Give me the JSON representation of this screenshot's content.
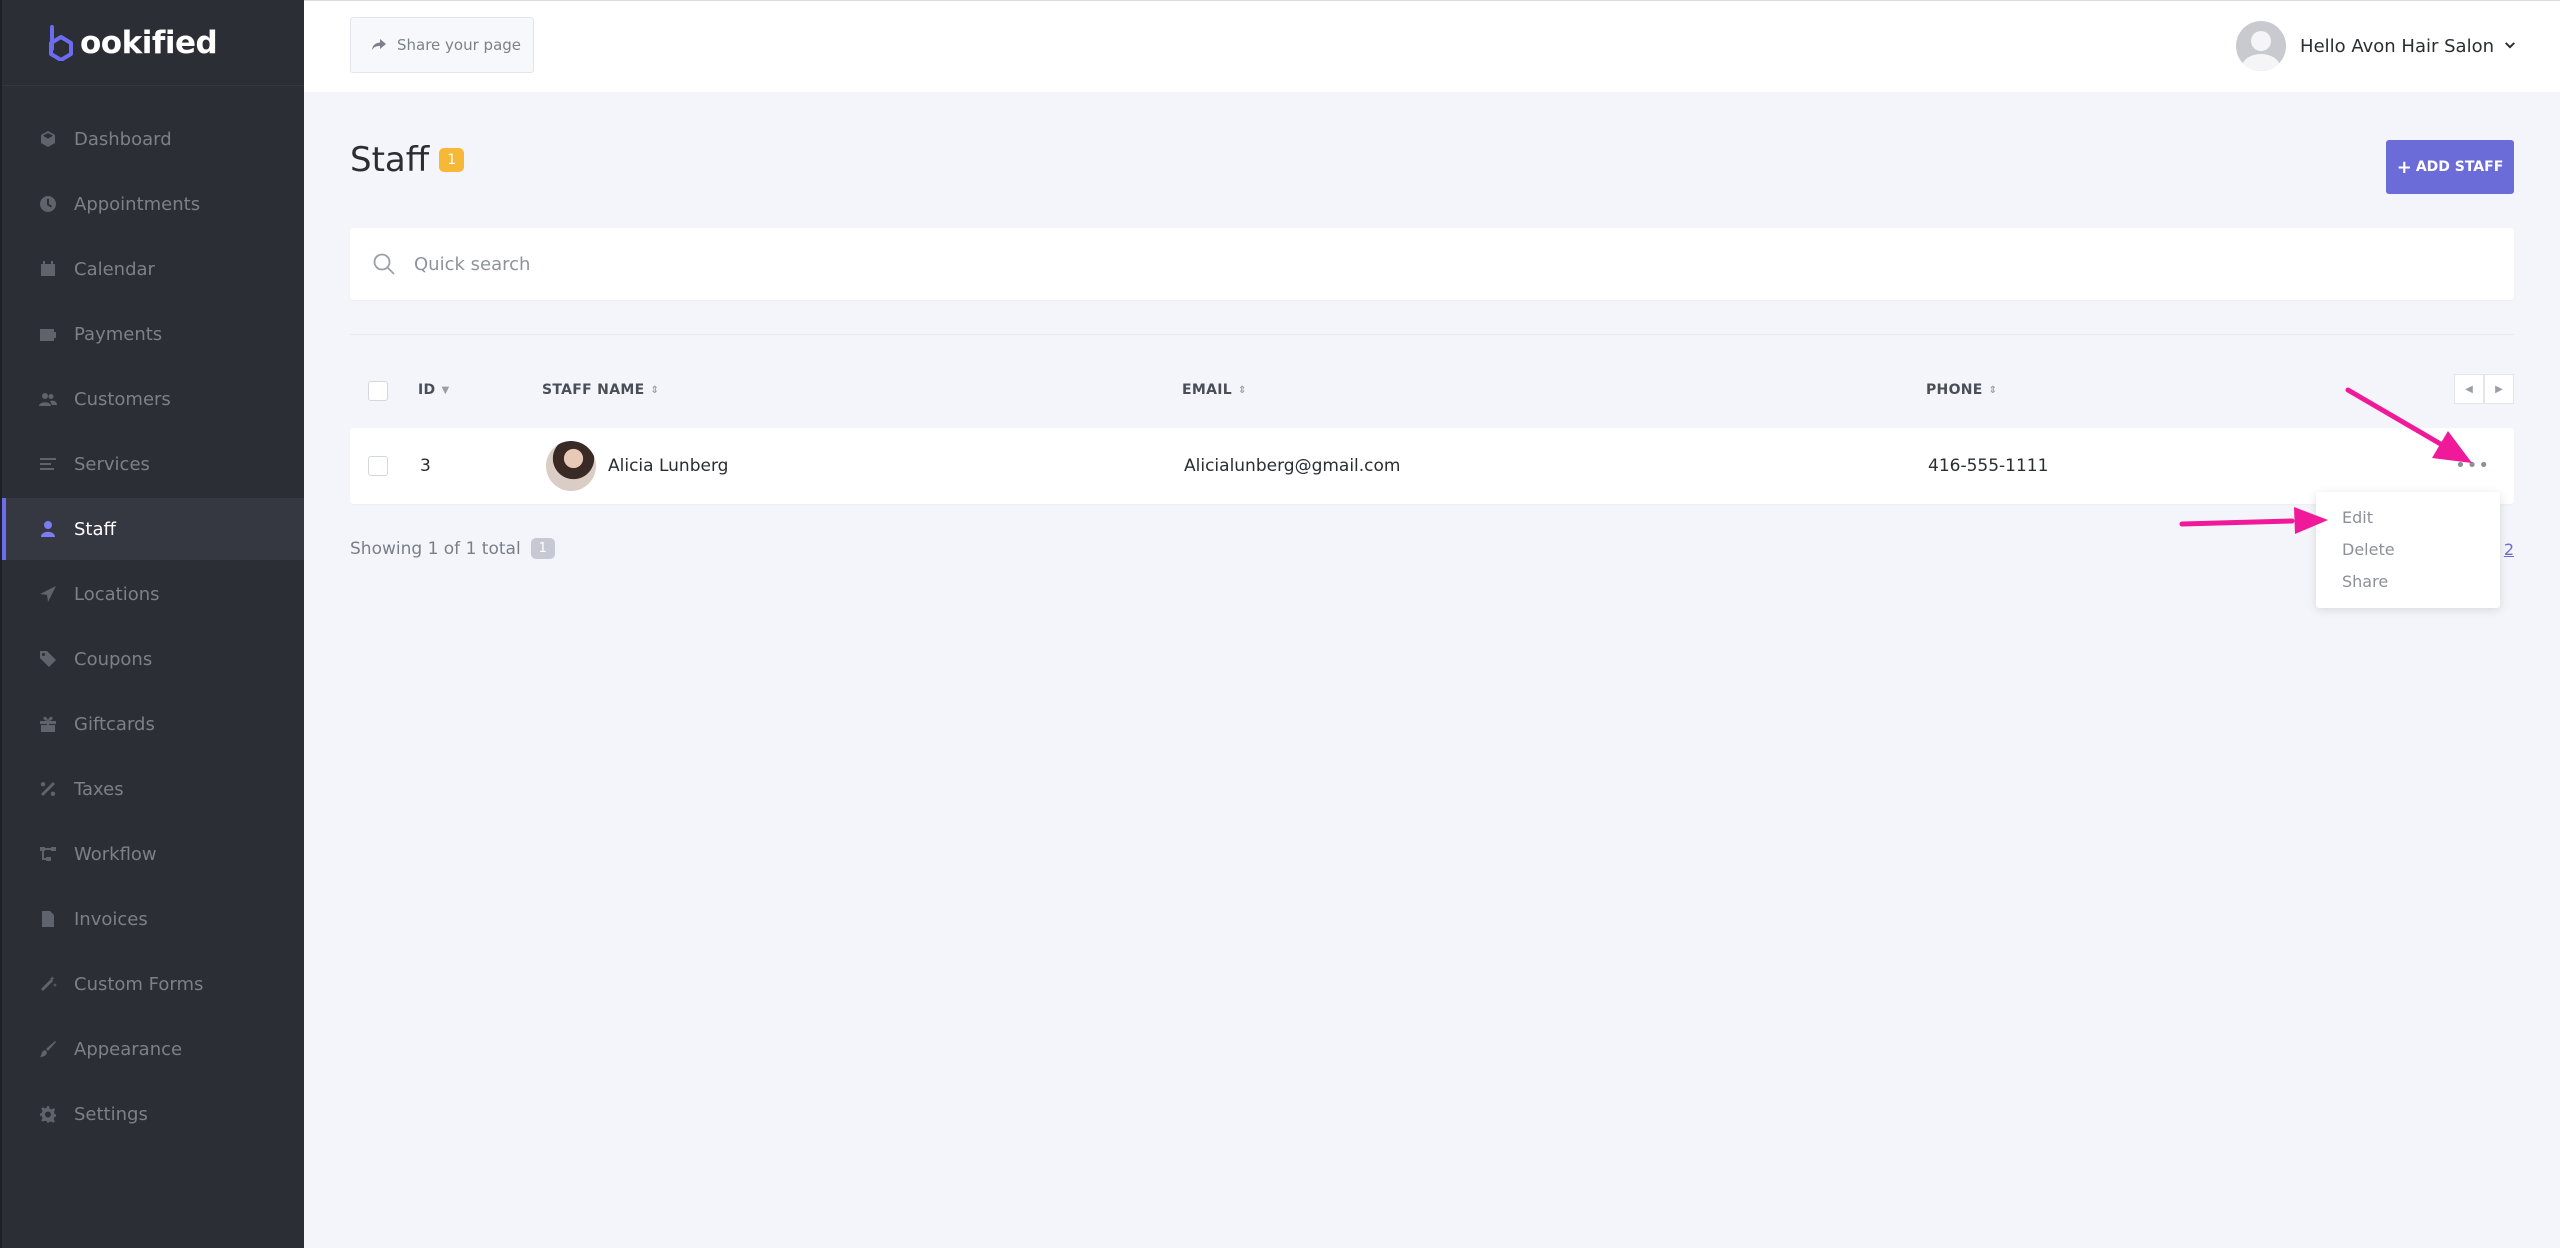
{
  "app": {
    "logo_text": "ookified",
    "accent_color": "#6c6cd9"
  },
  "sidebar": {
    "items": [
      {
        "label": "Dashboard",
        "icon": "cube-icon"
      },
      {
        "label": "Appointments",
        "icon": "clock-icon"
      },
      {
        "label": "Calendar",
        "icon": "calendar-icon"
      },
      {
        "label": "Payments",
        "icon": "wallet-icon"
      },
      {
        "label": "Customers",
        "icon": "users-icon"
      },
      {
        "label": "Services",
        "icon": "list-icon"
      },
      {
        "label": "Staff",
        "icon": "user-icon",
        "active": true
      },
      {
        "label": "Locations",
        "icon": "location-arrow-icon"
      },
      {
        "label": "Coupons",
        "icon": "tag-icon"
      },
      {
        "label": "Giftcards",
        "icon": "gift-icon"
      },
      {
        "label": "Taxes",
        "icon": "percent-icon"
      },
      {
        "label": "Workflow",
        "icon": "workflow-icon"
      },
      {
        "label": "Invoices",
        "icon": "file-icon"
      },
      {
        "label": "Custom Forms",
        "icon": "magic-wand-icon"
      },
      {
        "label": "Appearance",
        "icon": "brush-icon"
      },
      {
        "label": "Settings",
        "icon": "gear-icon"
      }
    ]
  },
  "topbar": {
    "share_label": "Share your page",
    "user_greeting": "Hello Avon Hair Salon"
  },
  "page": {
    "title": "Staff",
    "count": "1",
    "add_button_label": "ADD STAFF"
  },
  "search": {
    "placeholder": "Quick search"
  },
  "table": {
    "columns": {
      "id": "ID",
      "name": "STAFF NAME",
      "email": "EMAIL",
      "phone": "PHONE"
    },
    "rows": [
      {
        "id": "3",
        "name": "Alicia Lunberg",
        "email": "Alicialunberg@gmail.com",
        "phone": "416-555-1111"
      }
    ],
    "showing_text": "Showing 1 of 1 total",
    "current_page": "1",
    "page_link": "2"
  },
  "row_menu": {
    "items": [
      "Edit",
      "Delete",
      "Share"
    ]
  }
}
